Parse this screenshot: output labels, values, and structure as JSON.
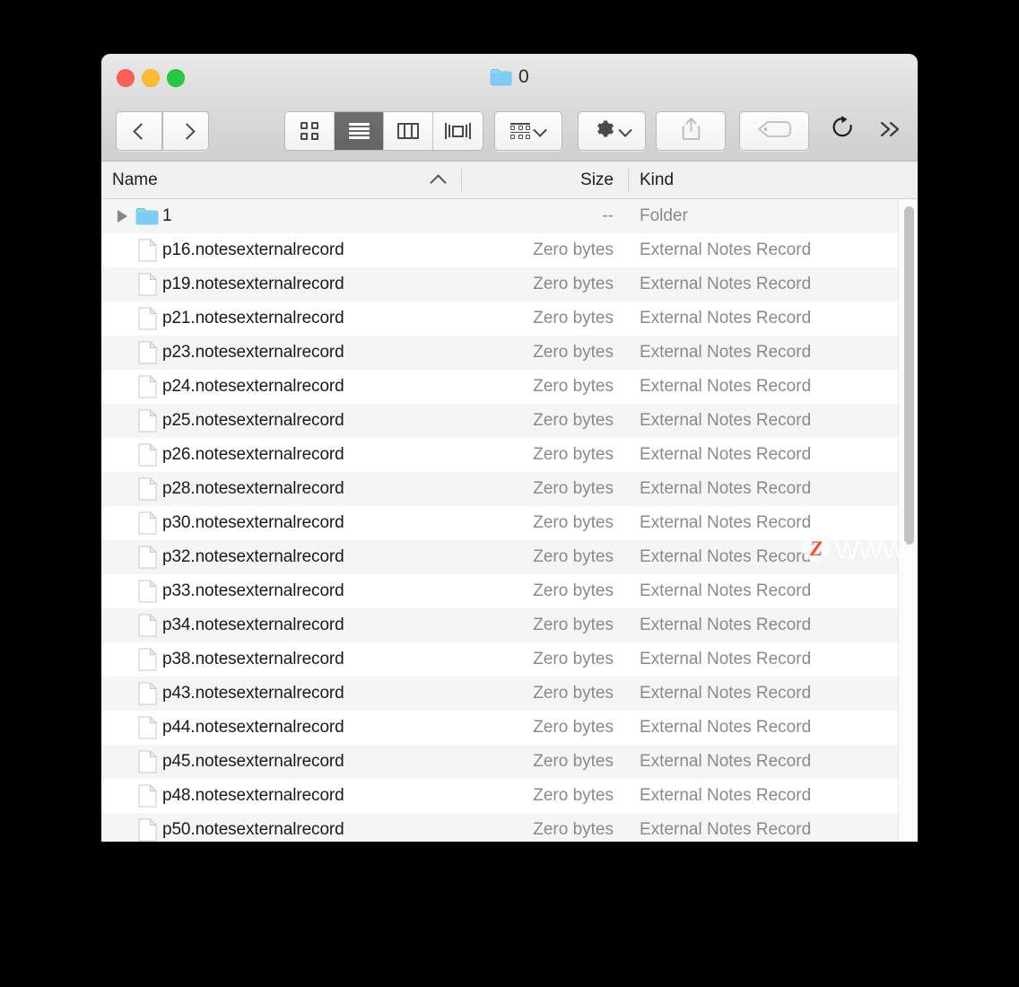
{
  "window": {
    "title": "0",
    "title_icon": "folder-icon",
    "traffic_lights": {
      "close": "close-window-button",
      "minimize": "minimize-window-button",
      "maximize": "maximize-window-button"
    }
  },
  "toolbar": {
    "back_label": "Back",
    "forward_label": "Forward",
    "view_modes": [
      {
        "id": "icon",
        "label": "Icon View",
        "selected": false,
        "icon": "icon-view-icon"
      },
      {
        "id": "list",
        "label": "List View",
        "selected": true,
        "icon": "list-view-icon"
      },
      {
        "id": "column",
        "label": "Column View",
        "selected": false,
        "icon": "column-view-icon"
      },
      {
        "id": "flow",
        "label": "Cover Flow",
        "selected": false,
        "icon": "cover-flow-icon"
      }
    ],
    "arrange_label": "Arrange",
    "action_label": "Action",
    "share_label": "Share",
    "tags_label": "Edit Tags",
    "refresh_label": "Refresh",
    "more_label": "More Toolbar Items"
  },
  "columns": [
    {
      "key": "name",
      "label": "Name",
      "sorted": true,
      "sort_direction": "ascending"
    },
    {
      "key": "size",
      "label": "Size",
      "sorted": false,
      "sort_direction": ""
    },
    {
      "key": "kind",
      "label": "Kind",
      "sorted": false,
      "sort_direction": ""
    }
  ],
  "rows": [
    {
      "name": "1",
      "size": "--",
      "kind": "Folder",
      "icon": "folder-icon",
      "expandable": true
    },
    {
      "name": "p16.notesexternalrecord",
      "size": "Zero bytes",
      "kind": "External Notes Record",
      "icon": "document-icon",
      "expandable": false
    },
    {
      "name": "p19.notesexternalrecord",
      "size": "Zero bytes",
      "kind": "External Notes Record",
      "icon": "document-icon",
      "expandable": false
    },
    {
      "name": "p21.notesexternalrecord",
      "size": "Zero bytes",
      "kind": "External Notes Record",
      "icon": "document-icon",
      "expandable": false
    },
    {
      "name": "p23.notesexternalrecord",
      "size": "Zero bytes",
      "kind": "External Notes Record",
      "icon": "document-icon",
      "expandable": false
    },
    {
      "name": "p24.notesexternalrecord",
      "size": "Zero bytes",
      "kind": "External Notes Record",
      "icon": "document-icon",
      "expandable": false
    },
    {
      "name": "p25.notesexternalrecord",
      "size": "Zero bytes",
      "kind": "External Notes Record",
      "icon": "document-icon",
      "expandable": false
    },
    {
      "name": "p26.notesexternalrecord",
      "size": "Zero bytes",
      "kind": "External Notes Record",
      "icon": "document-icon",
      "expandable": false
    },
    {
      "name": "p28.notesexternalrecord",
      "size": "Zero bytes",
      "kind": "External Notes Record",
      "icon": "document-icon",
      "expandable": false
    },
    {
      "name": "p30.notesexternalrecord",
      "size": "Zero bytes",
      "kind": "External Notes Record",
      "icon": "document-icon",
      "expandable": false
    },
    {
      "name": "p32.notesexternalrecord",
      "size": "Zero bytes",
      "kind": "External Notes Record",
      "icon": "document-icon",
      "expandable": false
    },
    {
      "name": "p33.notesexternalrecord",
      "size": "Zero bytes",
      "kind": "External Notes Record",
      "icon": "document-icon",
      "expandable": false
    },
    {
      "name": "p34.notesexternalrecord",
      "size": "Zero bytes",
      "kind": "External Notes Record",
      "icon": "document-icon",
      "expandable": false
    },
    {
      "name": "p38.notesexternalrecord",
      "size": "Zero bytes",
      "kind": "External Notes Record",
      "icon": "document-icon",
      "expandable": false
    },
    {
      "name": "p43.notesexternalrecord",
      "size": "Zero bytes",
      "kind": "External Notes Record",
      "icon": "document-icon",
      "expandable": false
    },
    {
      "name": "p44.notesexternalrecord",
      "size": "Zero bytes",
      "kind": "External Notes Record",
      "icon": "document-icon",
      "expandable": false
    },
    {
      "name": "p45.notesexternalrecord",
      "size": "Zero bytes",
      "kind": "External Notes Record",
      "icon": "document-icon",
      "expandable": false
    },
    {
      "name": "p48.notesexternalrecord",
      "size": "Zero bytes",
      "kind": "External Notes Record",
      "icon": "document-icon",
      "expandable": false
    },
    {
      "name": "p50.notesexternalrecord",
      "size": "Zero bytes",
      "kind": "External Notes Record",
      "icon": "document-icon",
      "expandable": false
    }
  ],
  "watermark": {
    "badge_letter": "Z",
    "text": "www.MacZ.com"
  },
  "colors": {
    "accent_orange": "#f2512c",
    "folder_blue": "#6ecbf5",
    "selected_segment": "#686868",
    "secondary_text": "#8a8a8a"
  }
}
